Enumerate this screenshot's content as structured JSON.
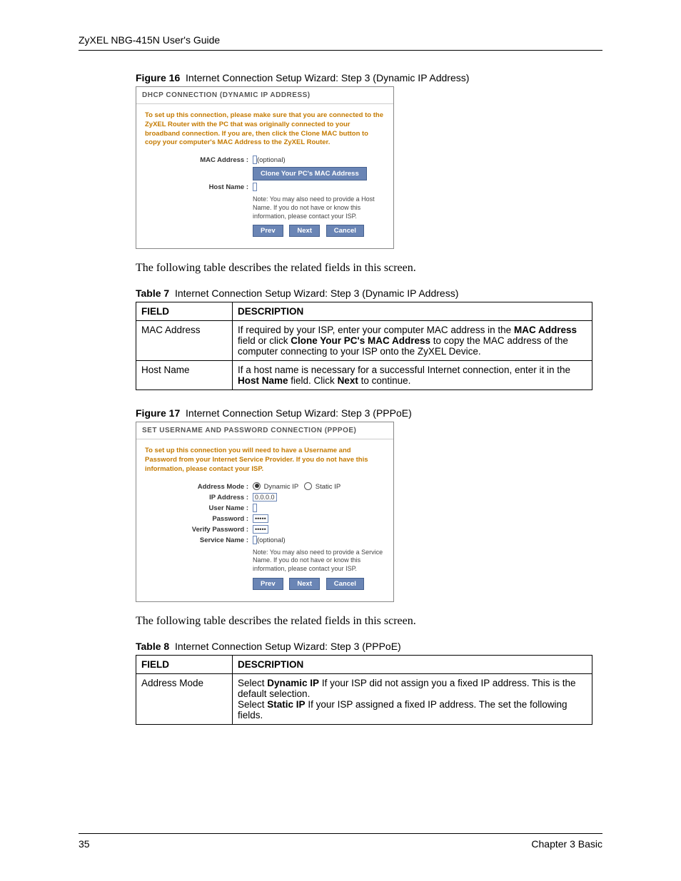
{
  "header": "ZyXEL NBG-415N User's Guide",
  "fig16": {
    "label": "Figure 16",
    "title": "Internet Connection Setup Wizard: Step 3 (Dynamic IP Address)",
    "panel_title": "DHCP CONNECTION (DYNAMIC IP ADDRESS)",
    "intro": "To set up this connection, please make sure that you are connected to the ZyXEL Router with the PC that was originally connected to your broadband connection. If you are, then click the Clone MAC button to copy your computer's MAC Address to the ZyXEL Router.",
    "mac_label": "MAC Address :",
    "optional": "(optional)",
    "clone_btn": "Clone Your PC's MAC Address",
    "host_label": "Host Name :",
    "note": "Note: You may also need to provide a Host Name. If you do not have or know this information, please contact your ISP.",
    "prev": "Prev",
    "next": "Next",
    "cancel": "Cancel"
  },
  "para1": "The following table describes the related fields in this screen.",
  "table7": {
    "label": "Table 7",
    "title": "Internet Connection Setup Wizard: Step 3 (Dynamic IP Address)",
    "head_field": "FIELD",
    "head_desc": "DESCRIPTION",
    "rows": {
      "r0f": "MAC Address",
      "r0d_a": "If required by your ISP, enter your computer MAC address in the ",
      "r0d_b": "MAC Address",
      "r0d_c": " field or click ",
      "r0d_d": "Clone Your PC's MAC Address",
      "r0d_e": " to copy the MAC address of the computer connecting to your ISP onto the ZyXEL Device.",
      "r1f": "Host Name",
      "r1d_a": "If a host name is necessary for a successful Internet connection, enter it in the ",
      "r1d_b": "Host Name",
      "r1d_c": " field. Click ",
      "r1d_d": "Next",
      "r1d_e": " to continue."
    }
  },
  "fig17": {
    "label": "Figure 17",
    "title": "Internet Connection Setup Wizard: Step 3 (PPPoE)",
    "panel_title": "SET USERNAME AND PASSWORD CONNECTION (PPPOE)",
    "intro": "To set up this connection you will need to have a Username and Password from your Internet Service Provider. If you do not have this information, please contact your ISP.",
    "addr_mode": "Address Mode :",
    "dyn": "Dynamic IP",
    "sta": "Static IP",
    "ip_label": "IP Address :",
    "ip_value": "0.0.0.0",
    "user_label": "User Name :",
    "pass_label": "Password :",
    "pass_value": "•••••",
    "vpass_label": "Verify Password :",
    "vpass_value": "•••••",
    "service_label": "Service Name :",
    "optional": "(optional)",
    "note": "Note: You may also need to provide a Service Name. If you do not have or know this information, please contact your ISP.",
    "prev": "Prev",
    "next": "Next",
    "cancel": "Cancel"
  },
  "para2": "The following table describes the related fields in this screen.",
  "table8": {
    "label": "Table 8",
    "title": "Internet Connection Setup Wizard: Step 3 (PPPoE)",
    "head_field": "FIELD",
    "head_desc": "DESCRIPTION",
    "rows": {
      "r0f": "Address Mode",
      "r0d_a": "Select ",
      "r0d_b": "Dynamic IP",
      "r0d_c": " If your ISP did not assign you a fixed IP address. This is the default selection.",
      "r0d_d": "Select ",
      "r0d_e": "Static IP",
      "r0d_f": " If your ISP assigned a fixed IP address. The set the following fields."
    }
  },
  "footer": {
    "page": "35",
    "chapter": "Chapter 3 Basic"
  }
}
